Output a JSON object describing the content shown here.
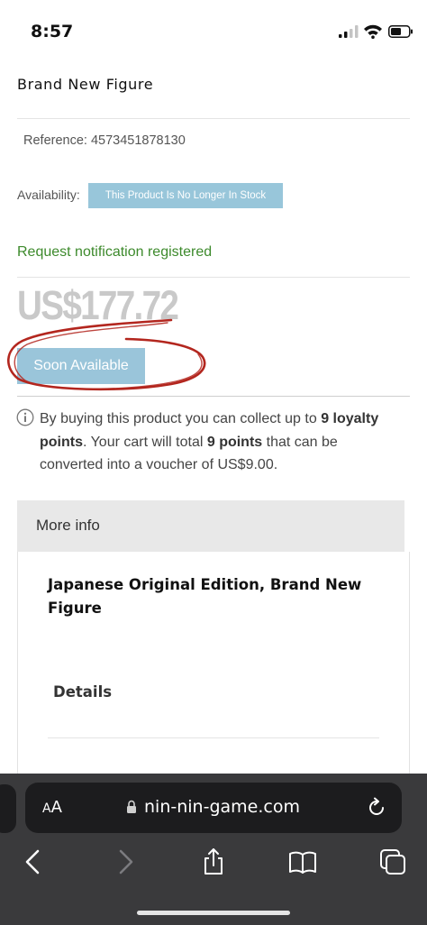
{
  "status_bar": {
    "time": "8:57"
  },
  "product": {
    "title": "Brand New Figure",
    "reference_label": "Reference:",
    "reference_value": "4573451878130",
    "availability_label": "Availability:",
    "availability_badge": "This Product Is No Longer In Stock",
    "notification": "Request notification registered",
    "price": "US$177.72",
    "soon_button": "Soon Available",
    "loyalty": {
      "part1": "By buying this product you can collect up to ",
      "points1": "9 loyalty points",
      "part2": ". Your cart will total ",
      "points2": "9 points",
      "part3": " that can be converted into a voucher of US$9.00."
    }
  },
  "more_info": {
    "header": "More info",
    "description": "Japanese Original Edition, Brand New Figure",
    "details_heading": "Details"
  },
  "browser": {
    "aa_label": "AA",
    "url": "nin-nin-game.com"
  },
  "colors": {
    "badge": "#98c6da",
    "notification": "#3d8a2c",
    "price": "#c9c9c9",
    "annotation": "#b3261e"
  }
}
